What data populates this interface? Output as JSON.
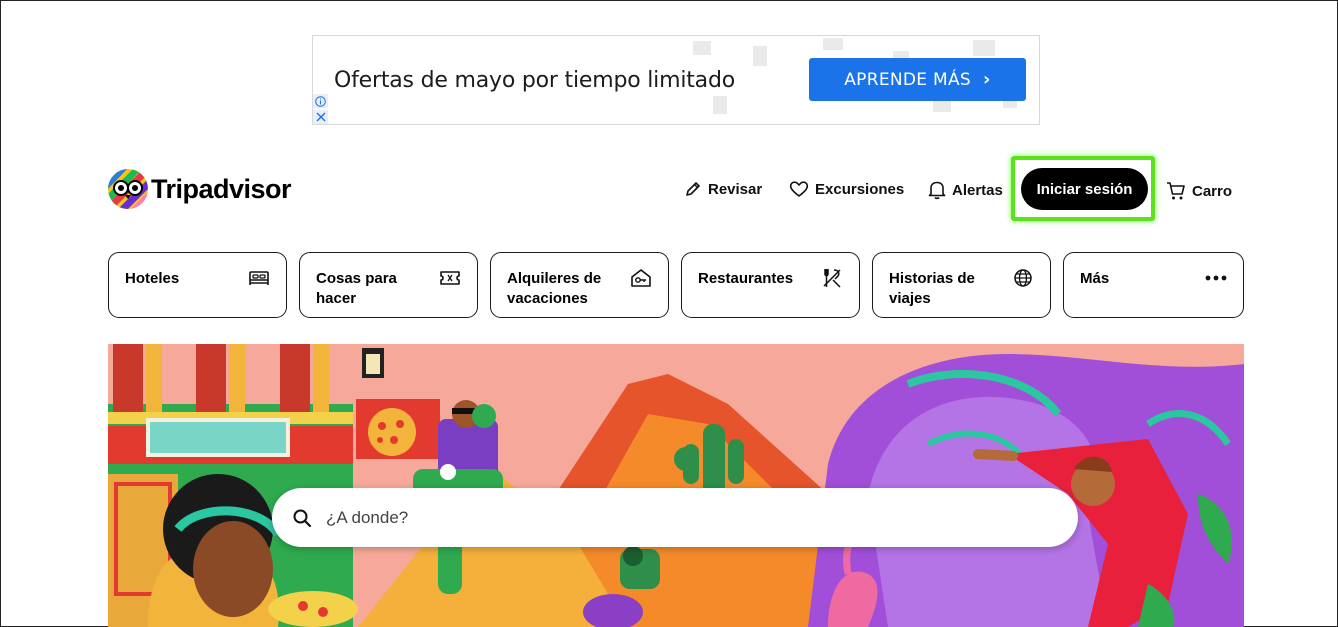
{
  "ad": {
    "headline": "Ofertas de mayo por tiempo limitado",
    "cta_label": "APRENDE MÁS",
    "cta_color": "#1a73e8"
  },
  "header": {
    "brand": "Tripadvisor",
    "nav": {
      "review": "Revisar",
      "trips": "Excursiones",
      "alerts": "Alertas",
      "signin": "Iniciar sesión",
      "cart": "Carro"
    },
    "highlight_color": "#5ce21c"
  },
  "categories": [
    {
      "label": "Hoteles",
      "icon": "bed-icon"
    },
    {
      "label": "Cosas para hacer",
      "icon": "ticket-icon"
    },
    {
      "label": "Alquileres de vacaciones",
      "icon": "house-key-icon"
    },
    {
      "label": "Restaurantes",
      "icon": "utensils-icon"
    },
    {
      "label": "Historias de viajes",
      "icon": "globe-icon"
    },
    {
      "label": "Más",
      "icon": "more-dots-icon"
    }
  ],
  "search": {
    "placeholder": "¿A donde?"
  }
}
